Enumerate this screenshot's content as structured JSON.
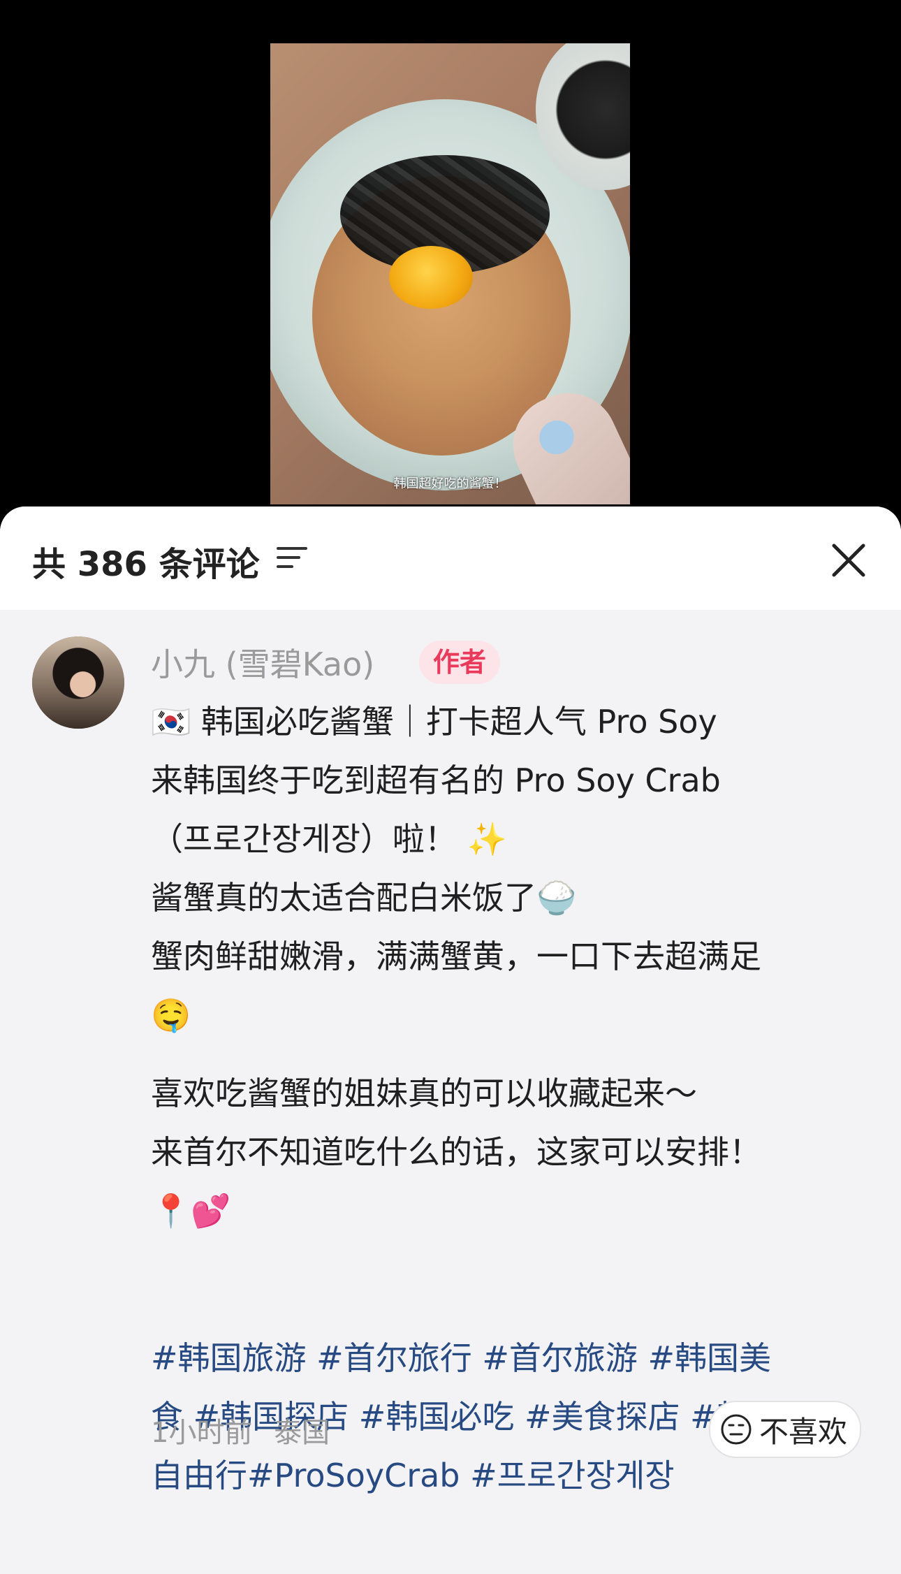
{
  "video": {
    "subtitle": "韩国超好吃的酱蟹！"
  },
  "comments_sheet": {
    "title": "共 386 条评论",
    "icons": {
      "sort": "sort-lines-icon",
      "close": "close-x-icon"
    }
  },
  "comment": {
    "author": "小九 (雪碧Kao)",
    "badge": "作者",
    "lines": [
      "🇰🇷 韩国必吃酱蟹｜打卡超人气 Pro Soy",
      "来韩国终于吃到超有名的 Pro Soy Crab",
      "（프로간장게장）啦！ ✨",
      "酱蟹真的太适合配白米饭了🍚",
      "蟹肉鲜甜嫩滑，满满蟹黄，一口下去超满足",
      "🤤"
    ],
    "lines2": [
      "喜欢吃酱蟹的姐妹真的可以收藏起来～",
      "来首尔不知道吃什么的话，这家可以安排！",
      "📍💕"
    ],
    "hashtags": [
      "#韩国旅游 #首尔旅行 #首尔旅游 #韩国美",
      "食 #韩国探店 #韩国必吃  #美食探店 #韩国",
      "自由行#ProSoyCrab #프로간장게장"
    ],
    "time": "1小时前",
    "location": "泰国",
    "dislike_label": "不喜欢"
  }
}
